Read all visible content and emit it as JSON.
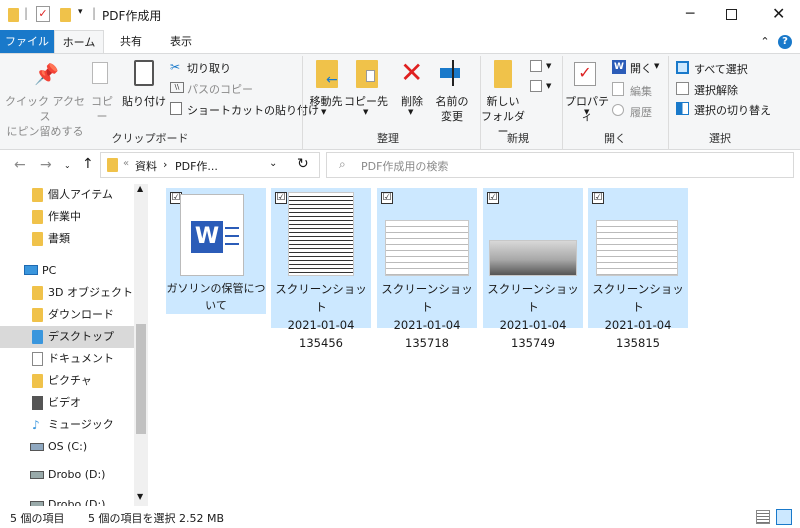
{
  "window": {
    "title": "PDF作成用"
  },
  "ribbon_tabs": [
    "ファイル",
    "ホーム",
    "共有",
    "表示"
  ],
  "clipboard": {
    "pin": "クイック アクセス\nにピン留めする",
    "copy": "コピー",
    "paste": "貼り付け",
    "cut": "切り取り",
    "copy_path": "パスのコピー",
    "paste_shortcut": "ショートカットの貼り付け",
    "group": "クリップボード"
  },
  "organize": {
    "move_to": "移動先",
    "copy_to": "コピー先",
    "delete": "削除",
    "rename": "名前の\n変更",
    "group": "整理"
  },
  "new": {
    "new_folder": "新しい\nフォルダー",
    "group": "新規"
  },
  "open": {
    "properties": "プロパティ",
    "open": "開く",
    "edit": "編集",
    "history": "履歴",
    "group": "開く"
  },
  "select": {
    "select_all": "すべて選択",
    "select_none": "選択解除",
    "invert": "選択の切り替え",
    "group": "選択"
  },
  "address": {
    "crumb1": "資料",
    "crumb2": "PDF作...",
    "search_placeholder": "PDF作成用の検索"
  },
  "nav": {
    "items": [
      {
        "label": "個人アイテム",
        "icon": "folder-icon"
      },
      {
        "label": "作業中",
        "icon": "folder-icon"
      },
      {
        "label": "書類",
        "icon": "folder-icon"
      },
      {
        "label": "PC",
        "icon": "pc-icon"
      },
      {
        "label": "3D オブジェクト",
        "icon": "3d-objects-icon"
      },
      {
        "label": "ダウンロード",
        "icon": "downloads-icon"
      },
      {
        "label": "デスクトップ",
        "icon": "desktop-icon"
      },
      {
        "label": "ドキュメント",
        "icon": "documents-icon"
      },
      {
        "label": "ピクチャ",
        "icon": "pictures-icon"
      },
      {
        "label": "ビデオ",
        "icon": "videos-icon"
      },
      {
        "label": "ミュージック",
        "icon": "music-icon"
      },
      {
        "label": "OS (C:)",
        "icon": "drive-c-icon"
      },
      {
        "label": "Drobo (D:)",
        "icon": "drive-d-icon"
      },
      {
        "label": "Drobo (D:)",
        "icon": "drive-d-icon"
      }
    ]
  },
  "files": [
    {
      "name": "ガソリンの保管について",
      "type": "word-doc",
      "checked": "☑"
    },
    {
      "name": "スクリーンショット\n2021-01-04\n135456",
      "type": "screenshot",
      "checked": "☑"
    },
    {
      "name": "スクリーンショット\n2021-01-04\n135718",
      "type": "screenshot",
      "checked": "☑"
    },
    {
      "name": "スクリーンショット\n2021-01-04\n135749",
      "type": "screenshot",
      "checked": "☑"
    },
    {
      "name": "スクリーンショット\n2021-01-04\n135815",
      "type": "screenshot",
      "checked": "☑"
    }
  ],
  "status": {
    "count": "5 個の項目",
    "selected": "5 個の項目を選択 2.52 MB"
  },
  "colors": {
    "accent": "#1979ca",
    "selection": "#cce8ff",
    "selection_border": "#99d1ff"
  }
}
